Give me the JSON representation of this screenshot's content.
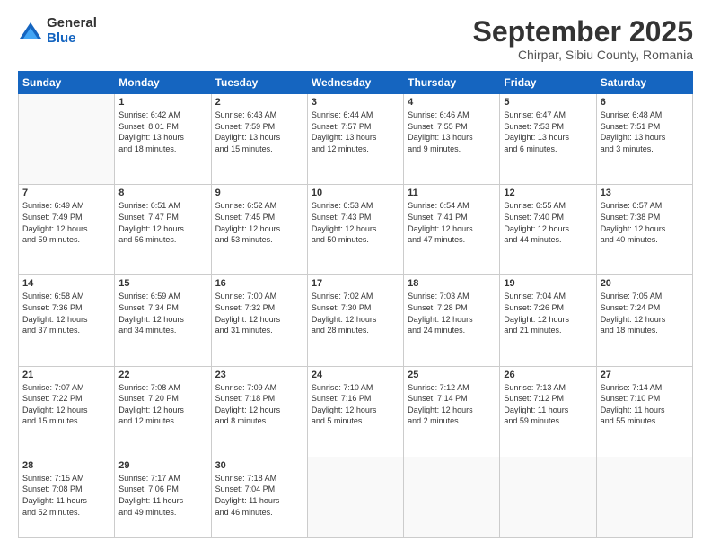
{
  "logo": {
    "general": "General",
    "blue": "Blue"
  },
  "title": "September 2025",
  "subtitle": "Chirpar, Sibiu County, Romania",
  "weekdays": [
    "Sunday",
    "Monday",
    "Tuesday",
    "Wednesday",
    "Thursday",
    "Friday",
    "Saturday"
  ],
  "weeks": [
    [
      {
        "num": "",
        "info": ""
      },
      {
        "num": "1",
        "info": "Sunrise: 6:42 AM\nSunset: 8:01 PM\nDaylight: 13 hours\nand 18 minutes."
      },
      {
        "num": "2",
        "info": "Sunrise: 6:43 AM\nSunset: 7:59 PM\nDaylight: 13 hours\nand 15 minutes."
      },
      {
        "num": "3",
        "info": "Sunrise: 6:44 AM\nSunset: 7:57 PM\nDaylight: 13 hours\nand 12 minutes."
      },
      {
        "num": "4",
        "info": "Sunrise: 6:46 AM\nSunset: 7:55 PM\nDaylight: 13 hours\nand 9 minutes."
      },
      {
        "num": "5",
        "info": "Sunrise: 6:47 AM\nSunset: 7:53 PM\nDaylight: 13 hours\nand 6 minutes."
      },
      {
        "num": "6",
        "info": "Sunrise: 6:48 AM\nSunset: 7:51 PM\nDaylight: 13 hours\nand 3 minutes."
      }
    ],
    [
      {
        "num": "7",
        "info": "Sunrise: 6:49 AM\nSunset: 7:49 PM\nDaylight: 12 hours\nand 59 minutes."
      },
      {
        "num": "8",
        "info": "Sunrise: 6:51 AM\nSunset: 7:47 PM\nDaylight: 12 hours\nand 56 minutes."
      },
      {
        "num": "9",
        "info": "Sunrise: 6:52 AM\nSunset: 7:45 PM\nDaylight: 12 hours\nand 53 minutes."
      },
      {
        "num": "10",
        "info": "Sunrise: 6:53 AM\nSunset: 7:43 PM\nDaylight: 12 hours\nand 50 minutes."
      },
      {
        "num": "11",
        "info": "Sunrise: 6:54 AM\nSunset: 7:41 PM\nDaylight: 12 hours\nand 47 minutes."
      },
      {
        "num": "12",
        "info": "Sunrise: 6:55 AM\nSunset: 7:40 PM\nDaylight: 12 hours\nand 44 minutes."
      },
      {
        "num": "13",
        "info": "Sunrise: 6:57 AM\nSunset: 7:38 PM\nDaylight: 12 hours\nand 40 minutes."
      }
    ],
    [
      {
        "num": "14",
        "info": "Sunrise: 6:58 AM\nSunset: 7:36 PM\nDaylight: 12 hours\nand 37 minutes."
      },
      {
        "num": "15",
        "info": "Sunrise: 6:59 AM\nSunset: 7:34 PM\nDaylight: 12 hours\nand 34 minutes."
      },
      {
        "num": "16",
        "info": "Sunrise: 7:00 AM\nSunset: 7:32 PM\nDaylight: 12 hours\nand 31 minutes."
      },
      {
        "num": "17",
        "info": "Sunrise: 7:02 AM\nSunset: 7:30 PM\nDaylight: 12 hours\nand 28 minutes."
      },
      {
        "num": "18",
        "info": "Sunrise: 7:03 AM\nSunset: 7:28 PM\nDaylight: 12 hours\nand 24 minutes."
      },
      {
        "num": "19",
        "info": "Sunrise: 7:04 AM\nSunset: 7:26 PM\nDaylight: 12 hours\nand 21 minutes."
      },
      {
        "num": "20",
        "info": "Sunrise: 7:05 AM\nSunset: 7:24 PM\nDaylight: 12 hours\nand 18 minutes."
      }
    ],
    [
      {
        "num": "21",
        "info": "Sunrise: 7:07 AM\nSunset: 7:22 PM\nDaylight: 12 hours\nand 15 minutes."
      },
      {
        "num": "22",
        "info": "Sunrise: 7:08 AM\nSunset: 7:20 PM\nDaylight: 12 hours\nand 12 minutes."
      },
      {
        "num": "23",
        "info": "Sunrise: 7:09 AM\nSunset: 7:18 PM\nDaylight: 12 hours\nand 8 minutes."
      },
      {
        "num": "24",
        "info": "Sunrise: 7:10 AM\nSunset: 7:16 PM\nDaylight: 12 hours\nand 5 minutes."
      },
      {
        "num": "25",
        "info": "Sunrise: 7:12 AM\nSunset: 7:14 PM\nDaylight: 12 hours\nand 2 minutes."
      },
      {
        "num": "26",
        "info": "Sunrise: 7:13 AM\nSunset: 7:12 PM\nDaylight: 11 hours\nand 59 minutes."
      },
      {
        "num": "27",
        "info": "Sunrise: 7:14 AM\nSunset: 7:10 PM\nDaylight: 11 hours\nand 55 minutes."
      }
    ],
    [
      {
        "num": "28",
        "info": "Sunrise: 7:15 AM\nSunset: 7:08 PM\nDaylight: 11 hours\nand 52 minutes."
      },
      {
        "num": "29",
        "info": "Sunrise: 7:17 AM\nSunset: 7:06 PM\nDaylight: 11 hours\nand 49 minutes."
      },
      {
        "num": "30",
        "info": "Sunrise: 7:18 AM\nSunset: 7:04 PM\nDaylight: 11 hours\nand 46 minutes."
      },
      {
        "num": "",
        "info": ""
      },
      {
        "num": "",
        "info": ""
      },
      {
        "num": "",
        "info": ""
      },
      {
        "num": "",
        "info": ""
      }
    ]
  ]
}
